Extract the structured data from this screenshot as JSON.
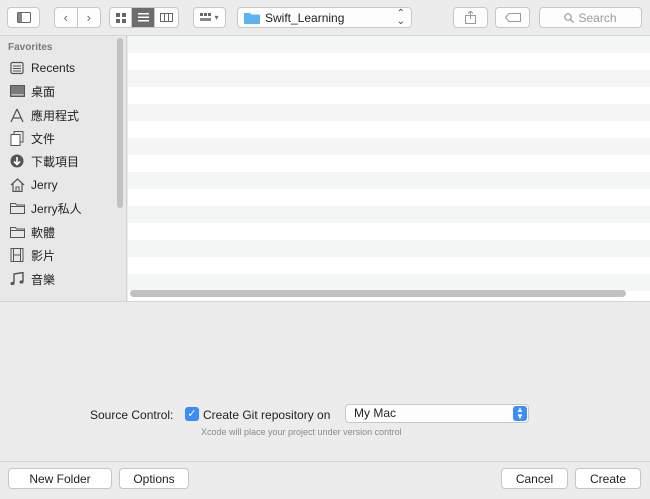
{
  "toolbar": {
    "location": "Swift_Learning",
    "search_placeholder": "Search"
  },
  "sidebar": {
    "header": "Favorites",
    "items": [
      {
        "label": "Recents",
        "icon": "recents-icon"
      },
      {
        "label": "桌面",
        "icon": "desktop-icon"
      },
      {
        "label": "應用程式",
        "icon": "applications-icon"
      },
      {
        "label": "文件",
        "icon": "documents-icon"
      },
      {
        "label": "下載項目",
        "icon": "downloads-icon"
      },
      {
        "label": "Jerry",
        "icon": "home-icon"
      },
      {
        "label": "Jerry私人",
        "icon": "folder-icon"
      },
      {
        "label": "軟體",
        "icon": "folder-icon"
      },
      {
        "label": "影片",
        "icon": "movies-icon"
      },
      {
        "label": "音樂",
        "icon": "music-icon"
      }
    ]
  },
  "source_control": {
    "label": "Source Control:",
    "checkbox_label": "Create Git repository on",
    "checked": true,
    "location_value": "My Mac",
    "hint": "Xcode will place your project under version control"
  },
  "footer": {
    "new_folder": "New Folder",
    "options": "Options",
    "cancel": "Cancel",
    "create": "Create"
  },
  "colors": {
    "accent": "#3a8ef6",
    "folder": "#5bb4f0"
  }
}
